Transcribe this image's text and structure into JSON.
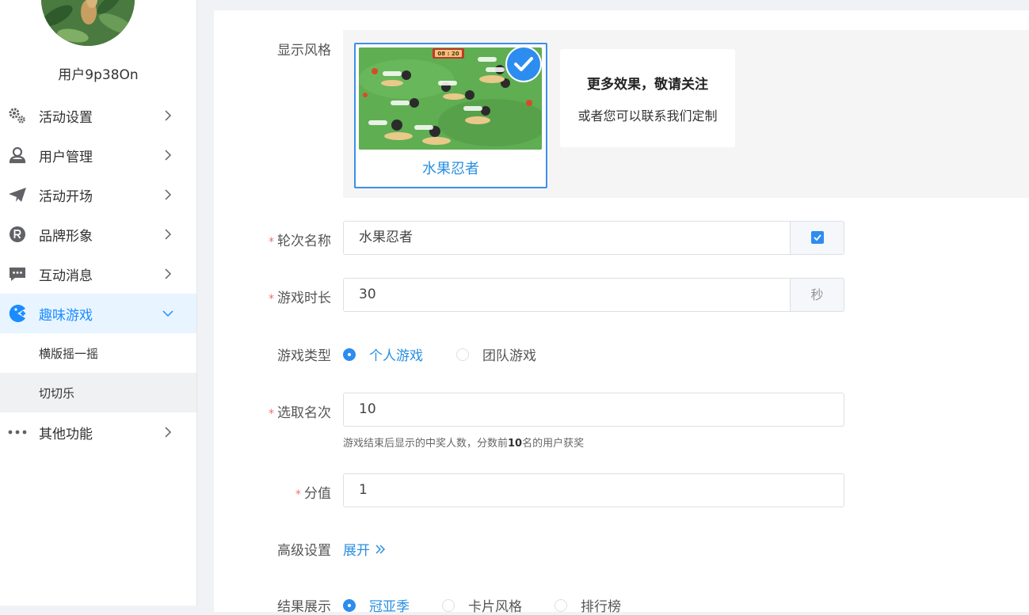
{
  "sidebar": {
    "username": "用户9p38On",
    "menu": [
      {
        "label": "活动设置",
        "icon": "gear-icon"
      },
      {
        "label": "用户管理",
        "icon": "user-icon"
      },
      {
        "label": "活动开场",
        "icon": "paper-plane-icon"
      },
      {
        "label": "品牌形象",
        "icon": "registered-icon"
      },
      {
        "label": "互动消息",
        "icon": "chat-icon"
      },
      {
        "label": "趣味游戏",
        "icon": "game-icon",
        "active": true
      },
      {
        "label": "其他功能",
        "icon": "more-dots-icon"
      }
    ],
    "submenu": [
      "横版摇一摇",
      "切切乐"
    ]
  },
  "form": {
    "display_style": {
      "label": "显示风格",
      "selected_name": "水果忍者",
      "thumb_timer": "08 : 20",
      "more_title": "更多效果，敬请关注",
      "more_sub": "或者您可以联系我们定制"
    },
    "round_name": {
      "label": "轮次名称",
      "value": "水果忍者"
    },
    "duration": {
      "label": "游戏时长",
      "value": "30",
      "unit": "秒"
    },
    "game_type": {
      "label": "游戏类型",
      "options": [
        "个人游戏",
        "团队游戏"
      ],
      "selected": "个人游戏"
    },
    "winners": {
      "label": "选取名次",
      "value": "10",
      "hint_prefix": "游戏结束后显示的中奖人数，分数前",
      "hint_num": "10",
      "hint_suffix": "名的用户获奖"
    },
    "score": {
      "label": "分值",
      "value": "1"
    },
    "advanced": {
      "label": "高级设置",
      "link": "展开"
    },
    "result": {
      "label": "结果展示",
      "options": [
        "冠亚季",
        "卡片风格",
        "排行榜"
      ],
      "selected": "冠亚季"
    }
  },
  "colors": {
    "accent": "#2d8cf0",
    "required": "#f56c6c",
    "active_bg": "#e8f4ff"
  }
}
